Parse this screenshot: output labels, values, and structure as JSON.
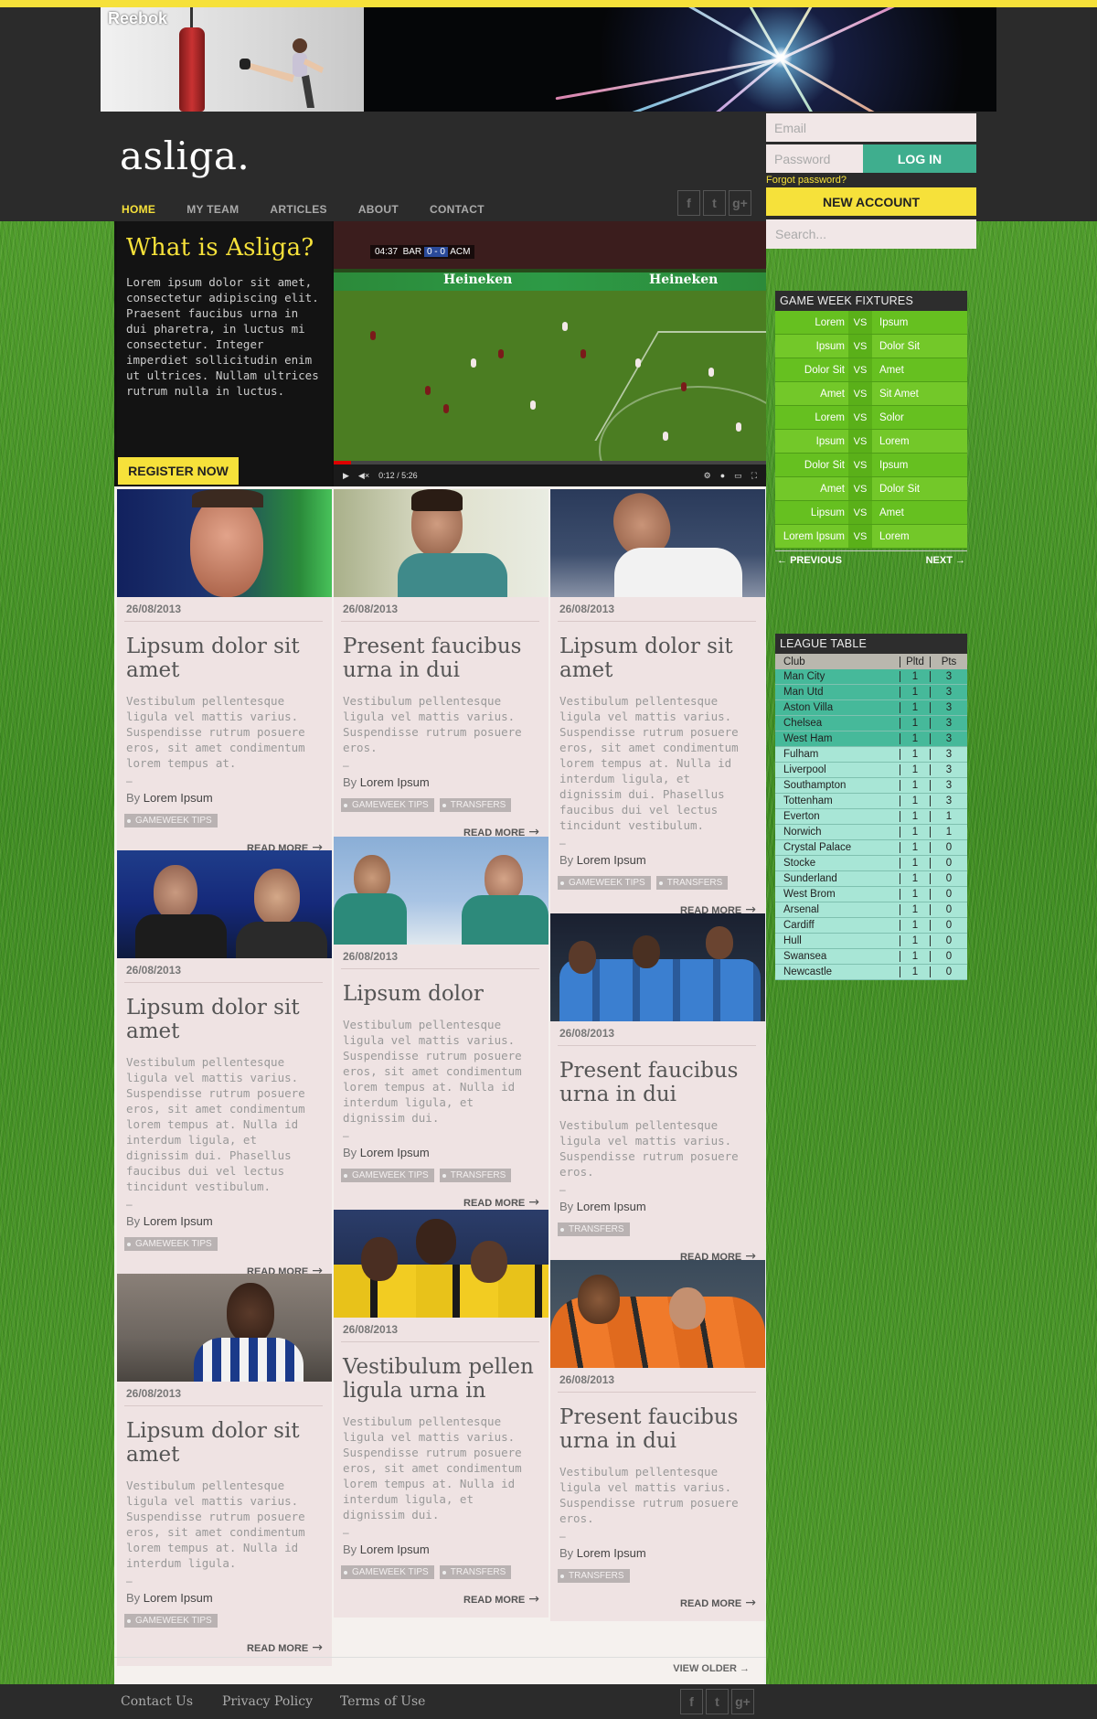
{
  "banner": {
    "brand": "Reebok"
  },
  "site": {
    "logo": "asliga."
  },
  "nav": {
    "items": [
      "HOME",
      "MY TEAM",
      "ARTICLES",
      "ABOUT",
      "CONTACT"
    ]
  },
  "social": {
    "facebook": "f",
    "twitter": "t",
    "gplus": "g+"
  },
  "login": {
    "email_placeholder": "Email",
    "password_placeholder": "Password",
    "login_label": "LOG IN",
    "forgot": "Forgot password?",
    "new_account": "NEW ACCOUNT"
  },
  "search": {
    "placeholder": "Search..."
  },
  "hero": {
    "title": "What is Asliga?",
    "body": "Lorem ipsum dolor sit amet, consectetur adipiscing elit. Praesent faucibus urna in dui pharetra, in luctus mi consectetur. Integer imperdiet sollicitudin enim ut ultrices. Nullam ultrices rutrum nulla in luctus.",
    "register": "REGISTER NOW"
  },
  "video": {
    "clock": "04:37",
    "home": "BAR",
    "score": "0 - 0",
    "away": "ACM",
    "board": "Heineken",
    "time": "0:12 / 5:26",
    "progress": 0.04
  },
  "cards": [
    {
      "date": "26/08/2013",
      "title": "Lipsum dolor sit amet",
      "desc": "Vestibulum pellentesque ligula vel mattis varius. Suspendisse rutrum posuere eros, sit amet condimentum lorem tempus at.",
      "dash": "–",
      "by_prefix": "By",
      "author": "Lorem Ipsum",
      "tags": [
        "GAMEWEEK TIPS"
      ],
      "more": "READ MORE"
    },
    {
      "date": "26/08/2013",
      "title": "Present faucibus urna in dui",
      "desc": "Vestibulum pellentesque ligula vel mattis varius. Suspendisse rutrum posuere eros.",
      "dash": "–",
      "by_prefix": "By",
      "author": "Lorem Ipsum",
      "tags": [
        "GAMEWEEK TIPS",
        "TRANSFERS"
      ],
      "more": "READ MORE"
    },
    {
      "date": "26/08/2013",
      "title": "Lipsum dolor sit amet",
      "desc": "Vestibulum pellentesque ligula vel mattis varius. Suspendisse rutrum posuere eros, sit amet condimentum lorem tempus at. Nulla id interdum ligula, et dignissim dui. Phasellus faucibus dui vel lectus tincidunt vestibulum.",
      "dash": "–",
      "by_prefix": "By",
      "author": "Lorem Ipsum",
      "tags": [
        "GAMEWEEK TIPS",
        "TRANSFERS"
      ],
      "more": "READ MORE"
    },
    {
      "date": "26/08/2013",
      "title": "Lipsum dolor sit amet",
      "desc": "Vestibulum pellentesque ligula vel mattis varius. Suspendisse rutrum posuere eros, sit amet condimentum lorem tempus at. Nulla id interdum ligula, et dignissim dui. Phasellus faucibus dui vel lectus tincidunt vestibulum.",
      "dash": "–",
      "by_prefix": "By",
      "author": "Lorem Ipsum",
      "tags": [
        "GAMEWEEK TIPS"
      ],
      "more": "READ MORE"
    },
    {
      "date": "26/08/2013",
      "title": "Lipsum dolor",
      "desc": "Vestibulum pellentesque ligula vel mattis varius. Suspendisse rutrum posuere eros, sit amet condimentum lorem tempus at. Nulla id interdum ligula, et dignissim dui.",
      "dash": "–",
      "by_prefix": "By",
      "author": "Lorem Ipsum",
      "tags": [
        "GAMEWEEK TIPS",
        "TRANSFERS"
      ],
      "more": "READ MORE"
    },
    {
      "date": "26/08/2013",
      "title": "Present faucibus urna in dui",
      "desc": "Vestibulum pellentesque ligula vel mattis varius. Suspendisse rutrum posuere eros.",
      "dash": "–",
      "by_prefix": "By",
      "author": "Lorem Ipsum",
      "tags": [
        "TRANSFERS"
      ],
      "more": "READ MORE"
    },
    {
      "date": "26/08/2013",
      "title": "Lipsum dolor sit amet",
      "desc": "Vestibulum pellentesque ligula vel mattis varius. Suspendisse rutrum posuere eros, sit amet condimentum lorem tempus at. Nulla id interdum ligula.",
      "dash": "–",
      "by_prefix": "By",
      "author": "Lorem Ipsum",
      "tags": [
        "GAMEWEEK TIPS"
      ],
      "more": "READ MORE"
    },
    {
      "date": "26/08/2013",
      "title": "Vestibulum pellen ligula urna in",
      "desc": "Vestibulum pellentesque ligula vel mattis varius. Suspendisse rutrum posuere eros, sit amet condimentum lorem tempus at. Nulla id interdum ligula, et dignissim dui.",
      "dash": "–",
      "by_prefix": "By",
      "author": "Lorem Ipsum",
      "tags": [
        "GAMEWEEK TIPS",
        "TRANSFERS"
      ],
      "more": "READ MORE"
    },
    {
      "date": "26/08/2013",
      "title": "Present faucibus urna in dui",
      "desc": "Vestibulum pellentesque ligula vel mattis varius. Suspendisse rutrum posuere eros.",
      "dash": "–",
      "by_prefix": "By",
      "author": "Lorem Ipsum",
      "tags": [
        "TRANSFERS"
      ],
      "more": "READ MORE"
    }
  ],
  "view_older": "VIEW OLDER",
  "fixtures": {
    "title": "GAME WEEK FIXTURES",
    "vs": "VS",
    "rows": [
      [
        "Lorem",
        "Ipsum"
      ],
      [
        "Ipsum",
        "Dolor Sit"
      ],
      [
        "Dolor Sit",
        "Amet"
      ],
      [
        "Amet",
        "Sit Amet"
      ],
      [
        "Lorem",
        "Solor"
      ],
      [
        "Ipsum",
        "Lorem"
      ],
      [
        "Dolor Sit",
        "Ipsum"
      ],
      [
        "Amet",
        "Dolor Sit"
      ],
      [
        "Lipsum",
        "Amet"
      ],
      [
        "Lorem Ipsum",
        "Lorem"
      ]
    ],
    "previous": "PREVIOUS",
    "next": "NEXT"
  },
  "league": {
    "title": "LEAGUE TABLE",
    "headers": [
      "Club",
      "Pltd",
      "Pts"
    ],
    "rows": [
      [
        "Man City",
        "1",
        "3"
      ],
      [
        "Man Utd",
        "1",
        "3"
      ],
      [
        "Aston Villa",
        "1",
        "3"
      ],
      [
        "Chelsea",
        "1",
        "3"
      ],
      [
        "West Ham",
        "1",
        "3"
      ],
      [
        "Fulham",
        "1",
        "3"
      ],
      [
        "Liverpool",
        "1",
        "3"
      ],
      [
        "Southampton",
        "1",
        "3"
      ],
      [
        "Tottenham",
        "1",
        "3"
      ],
      [
        "Everton",
        "1",
        "1"
      ],
      [
        "Norwich",
        "1",
        "1"
      ],
      [
        "Crystal Palace",
        "1",
        "0"
      ],
      [
        "Stocke",
        "1",
        "0"
      ],
      [
        "Sunderland",
        "1",
        "0"
      ],
      [
        "West Brom",
        "1",
        "0"
      ],
      [
        "Arsenal",
        "1",
        "0"
      ],
      [
        "Cardiff",
        "1",
        "0"
      ],
      [
        "Hull",
        "1",
        "0"
      ],
      [
        "Swansea",
        "1",
        "0"
      ],
      [
        "Newcastle",
        "1",
        "0"
      ]
    ],
    "top_rows": 5
  },
  "footer": {
    "links": [
      "Contact Us",
      "Privacy Policy",
      "Terms of Use"
    ]
  },
  "colors": {
    "accent": "#f6e13a",
    "teal": "#3fae8e",
    "dark": "#2b2b2b",
    "fixture_green": "#66c020"
  }
}
